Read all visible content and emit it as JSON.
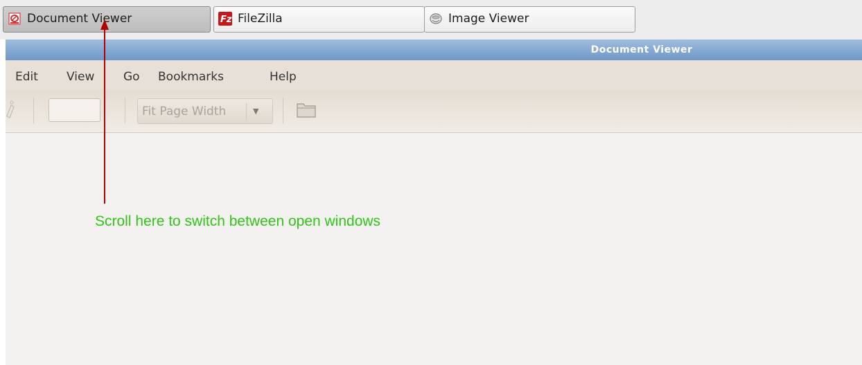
{
  "taskbar": {
    "tasks": [
      {
        "label": "Document Viewer",
        "icon": "document-viewer-icon",
        "active": true
      },
      {
        "label": "FileZilla",
        "icon": "filezilla-icon",
        "active": false
      },
      {
        "label": "Image Viewer",
        "icon": "image-viewer-icon",
        "active": false
      }
    ]
  },
  "window": {
    "title": "Document Viewer",
    "menu": [
      "Edit",
      "View",
      "Go",
      "Bookmarks",
      "Help"
    ],
    "toolbar": {
      "page_entry_value": "",
      "zoom_selected": "Fit Page Width"
    }
  },
  "annotation": {
    "text": "Scroll here to switch between open windows",
    "arrow_color": "#b00000",
    "text_color": "#33c21a"
  },
  "colors": {
    "titlebar": "#7fa3d0",
    "menubar": "#e6e0d8",
    "content_bg": "#f3f2f0"
  }
}
